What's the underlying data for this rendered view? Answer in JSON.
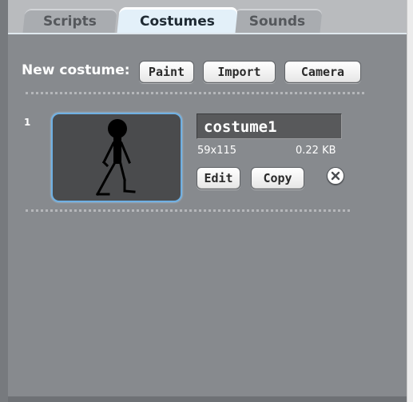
{
  "tabs": [
    {
      "label": "Scripts",
      "active": false
    },
    {
      "label": "Costumes",
      "active": true
    },
    {
      "label": "Sounds",
      "active": false
    }
  ],
  "new_costume": {
    "label": "New costume:",
    "buttons": {
      "paint": "Paint",
      "import": "Import",
      "camera": "Camera"
    }
  },
  "costumes": [
    {
      "number": "1",
      "name": "costume1",
      "dimensions": "59x115",
      "size": "0.22 KB",
      "edit_label": "Edit",
      "copy_label": "Copy",
      "thumbnail_icon": "stick-figure-icon"
    }
  ],
  "colors": {
    "panel_bg": "#878a8e",
    "active_tab": "#e3f0f9",
    "thumb_border": "#6fb0e3",
    "thumb_bg": "#4a4b4d",
    "name_field_bg": "#58595b"
  }
}
